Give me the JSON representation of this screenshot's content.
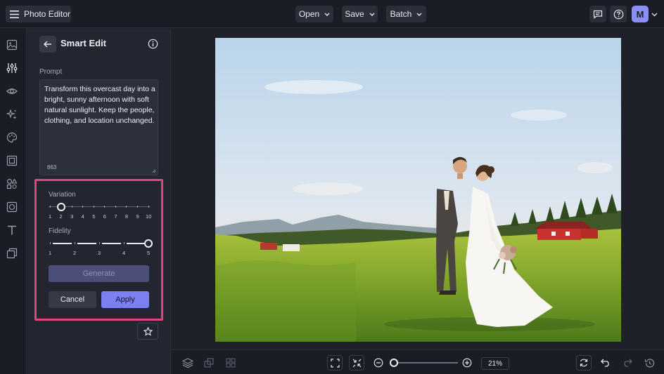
{
  "app": {
    "title": "Photo Editor",
    "avatar_initial": "M"
  },
  "menus": {
    "open": "Open",
    "save": "Save",
    "batch": "Batch"
  },
  "panel": {
    "title": "Smart Edit",
    "prompt_label": "Prompt",
    "prompt_text": "Transform this overcast day into a bright, sunny afternoon with soft natural sunlight. Keep the people, clothing, and location unchanged.",
    "char_count": "863",
    "variation_label": "Variation",
    "variation_ticks": [
      "1",
      "2",
      "3",
      "4",
      "5",
      "6",
      "7",
      "8",
      "9",
      "10"
    ],
    "variation_value": 2,
    "fidelity_label": "Fidelity",
    "fidelity_ticks": [
      "1",
      "2",
      "3",
      "4",
      "5"
    ],
    "fidelity_value": 5,
    "generate_label": "Generate",
    "cancel_label": "Cancel",
    "apply_label": "Apply"
  },
  "zoom": {
    "level": "21%",
    "value": 0.05
  },
  "colors": {
    "accent": "#7b7ff2",
    "highlight": "#e0457b"
  }
}
